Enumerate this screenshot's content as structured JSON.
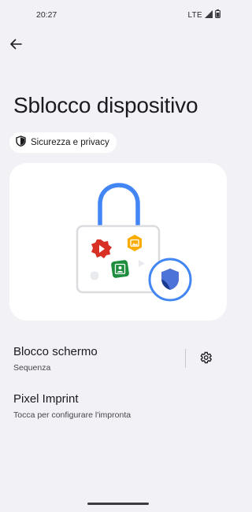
{
  "status_bar": {
    "time": "20:27",
    "network": "LTE"
  },
  "header": {
    "title": "Sblocco dispositivo"
  },
  "chip": {
    "label": "Sicurezza e privacy"
  },
  "preferences": [
    {
      "title": "Blocco schermo",
      "summary": "Sequenza"
    },
    {
      "title": "Pixel Imprint",
      "summary": "Tocca per configurare l'impronta"
    }
  ],
  "icons": {
    "back": "arrow-back-icon",
    "chip": "shield-icon",
    "settings": "gear-icon",
    "signal": "signal-icon",
    "battery": "battery-icon"
  },
  "colors": {
    "background": "#f2f1f6",
    "card": "#ffffff",
    "lock_shackle": "#4285f4",
    "shield_dark": "#1a3a8f",
    "shield_light": "#4d73d9"
  }
}
